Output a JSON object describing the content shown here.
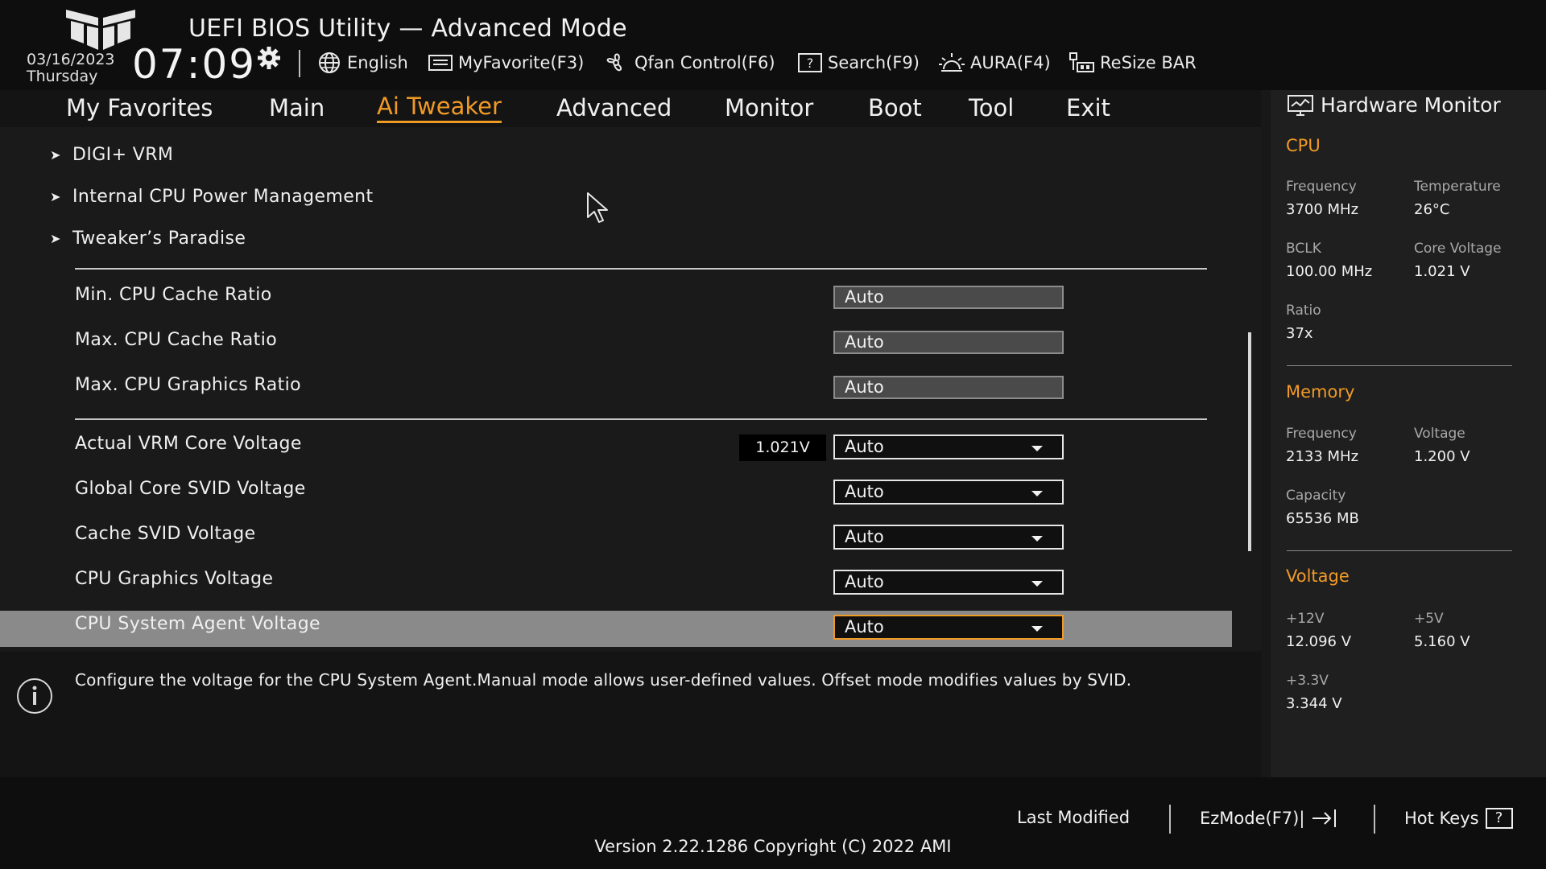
{
  "header": {
    "title": "UEFI BIOS Utility — Advanced Mode",
    "date": "03/16/2023",
    "day": "Thursday",
    "time": "07:09",
    "toolbar": [
      {
        "label": "English",
        "icon": "globe-icon"
      },
      {
        "label": "MyFavorite(F3)",
        "icon": "favorite-icon"
      },
      {
        "label": "Qfan Control(F6)",
        "icon": "fan-icon"
      },
      {
        "label": "Search(F9)",
        "icon": "search-icon"
      },
      {
        "label": "AURA(F4)",
        "icon": "aura-icon"
      },
      {
        "label": "ReSize BAR",
        "icon": "resize-bar-icon"
      }
    ]
  },
  "tabs": [
    {
      "label": "My Favorites",
      "active": false
    },
    {
      "label": "Main",
      "active": false
    },
    {
      "label": "Ai Tweaker",
      "active": true
    },
    {
      "label": "Advanced",
      "active": false
    },
    {
      "label": "Monitor",
      "active": false
    },
    {
      "label": "Boot",
      "active": false
    },
    {
      "label": "Tool",
      "active": false
    },
    {
      "label": "Exit",
      "active": false
    }
  ],
  "submenus": [
    {
      "label": "DIGI+ VRM"
    },
    {
      "label": "Internal CPU Power Management"
    },
    {
      "label": "Tweaker’s Paradise"
    }
  ],
  "ratio_settings": [
    {
      "label": "Min. CPU Cache Ratio",
      "value": "Auto"
    },
    {
      "label": "Max. CPU Cache Ratio",
      "value": "Auto"
    },
    {
      "label": "Max. CPU Graphics Ratio",
      "value": "Auto"
    }
  ],
  "voltage_settings": [
    {
      "label": "Actual VRM Core Voltage",
      "value": "Auto",
      "readout": "1.021V"
    },
    {
      "label": "Global Core SVID Voltage",
      "value": "Auto"
    },
    {
      "label": "Cache SVID Voltage",
      "value": "Auto"
    },
    {
      "label": "CPU Graphics Voltage",
      "value": "Auto"
    },
    {
      "label": "CPU System Agent Voltage",
      "value": "Auto",
      "selected": true
    }
  ],
  "help_text": "Configure the voltage for the CPU System Agent.Manual mode allows user-defined values. Offset mode modifies values by SVID.",
  "hardware_monitor": {
    "title": "Hardware Monitor",
    "cpu": {
      "heading": "CPU",
      "frequency_label": "Frequency",
      "frequency": "3700 MHz",
      "temperature_label": "Temperature",
      "temperature": "26°C",
      "bclk_label": "BCLK",
      "bclk": "100.00 MHz",
      "core_voltage_label": "Core Voltage",
      "core_voltage": "1.021 V",
      "ratio_label": "Ratio",
      "ratio": "37x"
    },
    "memory": {
      "heading": "Memory",
      "frequency_label": "Frequency",
      "frequency": "2133 MHz",
      "voltage_label": "Voltage",
      "voltage": "1.200 V",
      "capacity_label": "Capacity",
      "capacity": "65536 MB"
    },
    "voltage": {
      "heading": "Voltage",
      "v12_label": "+12V",
      "v12": "12.096 V",
      "v5_label": "+5V",
      "v5": "5.160 V",
      "v33_label": "+3.3V",
      "v33": "3.344 V"
    }
  },
  "footer": {
    "last_modified": "Last Modified",
    "ezmode": "EzMode(F7)|",
    "hot_keys": "Hot Keys",
    "hot_keys_glyph": "?",
    "version": "Version 2.22.1286 Copyright (C) 2022 AMI"
  },
  "colors": {
    "accent": "#f09a26",
    "highlight_row": "#8a8a8a",
    "background": "#1a1a1a"
  }
}
